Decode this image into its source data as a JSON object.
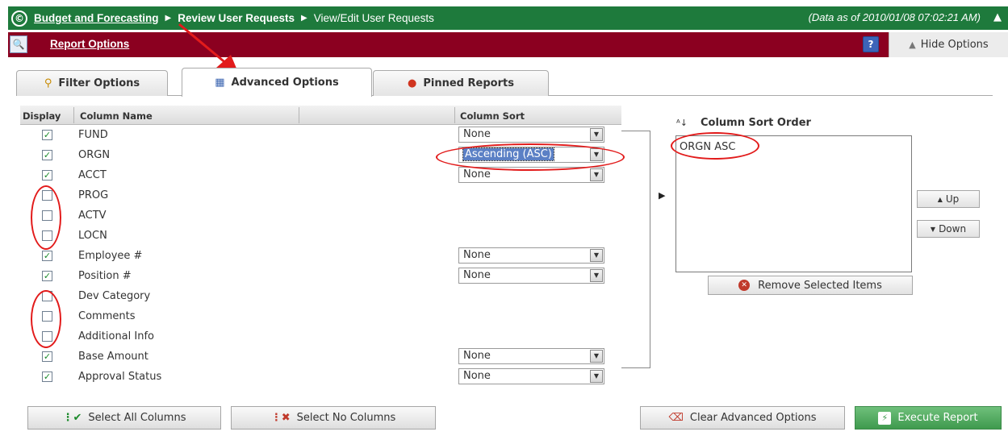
{
  "topbar": {
    "crumb1": "Budget and Forecasting",
    "crumb2": "Review User Requests",
    "crumb3": "View/Edit User Requests",
    "as_of": "(Data as of 2010/01/08 07:02:21 AM)"
  },
  "optbar": {
    "title": "Report Options",
    "help": "?",
    "hide_label": "Hide Options"
  },
  "tabs": [
    {
      "label": "Filter Options",
      "icon": "magnifier-icon"
    },
    {
      "label": "Advanced Options",
      "icon": "table-icon",
      "active": true
    },
    {
      "label": "Pinned Reports",
      "icon": "pin-icon"
    }
  ],
  "grid": {
    "headers": {
      "display": "Display",
      "column_name": "Column Name",
      "column_sort": "Column Sort"
    },
    "rows": [
      {
        "name": "FUND",
        "checked": true,
        "sort": "None"
      },
      {
        "name": "ORGN",
        "checked": true,
        "sort": "Ascending (ASC)"
      },
      {
        "name": "ACCT",
        "checked": true,
        "sort": "None"
      },
      {
        "name": "PROG",
        "checked": false,
        "sort": null
      },
      {
        "name": "ACTV",
        "checked": false,
        "sort": null
      },
      {
        "name": "LOCN",
        "checked": false,
        "sort": null
      },
      {
        "name": "Employee #",
        "checked": true,
        "sort": "None"
      },
      {
        "name": "Position #",
        "checked": true,
        "sort": "None"
      },
      {
        "name": "Dev Category",
        "checked": false,
        "sort": null
      },
      {
        "name": "Comments",
        "checked": false,
        "sort": null
      },
      {
        "name": "Additional Info",
        "checked": false,
        "sort": null
      },
      {
        "name": "Base Amount",
        "checked": true,
        "sort": "None"
      },
      {
        "name": "Approval Status",
        "checked": true,
        "sort": "None"
      }
    ]
  },
  "sort_panel": {
    "title": "Column Sort Order",
    "items": [
      "ORGN ASC"
    ],
    "up_label": "Up",
    "down_label": "Down",
    "remove_label": "Remove Selected Items"
  },
  "buttons": {
    "select_all": "Select All Columns",
    "select_none": "Select No Columns",
    "clear": "Clear Advanced Options",
    "execute": "Execute Report"
  },
  "colors": {
    "green_bar": "#1e7a3c",
    "red_bar": "#8b0020",
    "annotation": "#e21b1b",
    "execute": "#4caf50"
  }
}
